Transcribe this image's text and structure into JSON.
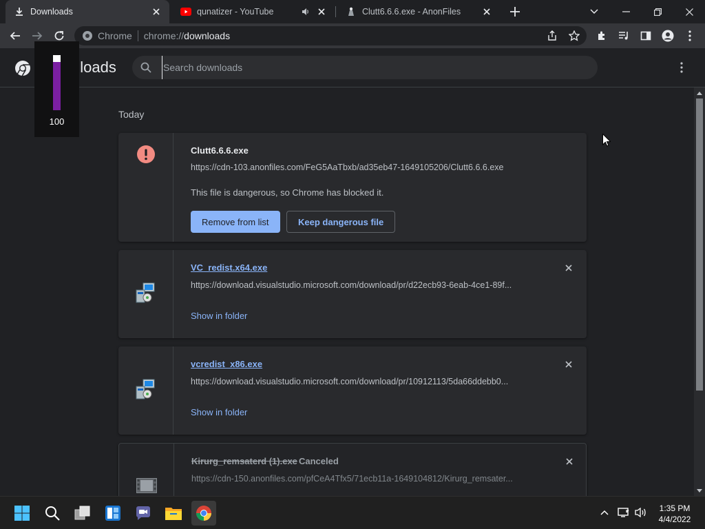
{
  "tabs": [
    {
      "title": "Downloads",
      "icon": "download-icon",
      "active": true
    },
    {
      "title": "qunatizer - YouTube",
      "icon": "youtube-icon",
      "audio": true
    },
    {
      "title": "Clutt6.6.6.exe - AnonFiles",
      "icon": "anonfiles-icon"
    }
  ],
  "omnibox": {
    "scheme": "Chrome",
    "host": "chrome://",
    "path": "downloads"
  },
  "header": {
    "title": "Downloads",
    "search_placeholder": "Search downloads"
  },
  "volume": {
    "value": "100",
    "level_percent": 100
  },
  "section": {
    "label": "Today"
  },
  "downloads": [
    {
      "name": "Clutt6.6.6.exe",
      "url": "https://cdn-103.anonfiles.com/FeG5AaTbxb/ad35eb47-1649105206/Clutt6.6.6.exe",
      "warning": "This file is dangerous, so Chrome has blocked it.",
      "primary_action": "Remove from list",
      "secondary_action": "Keep dangerous file",
      "icon": "error-icon"
    },
    {
      "name": "VC_redist.x64.exe",
      "url": "https://download.visualstudio.microsoft.com/download/pr/d22ecb93-6eab-4ce1-89f...",
      "action": "Show in folder",
      "icon": "installer-icon"
    },
    {
      "name": "vcredist_x86.exe",
      "url": "https://download.visualstudio.microsoft.com/download/pr/10912113/5da66ddebb0...",
      "action": "Show in folder",
      "icon": "installer-icon"
    },
    {
      "name": "Kirurg_remsaterd (1).exe",
      "status": "Canceled",
      "url": "https://cdn-150.anonfiles.com/pfCeA4Tfx5/71ecb11a-1649104812/Kirurg_remsater...",
      "icon": "video-file-icon"
    }
  ],
  "taskbar": {
    "apps": [
      "windows-start-icon",
      "search-icon",
      "task-view-icon",
      "widgets-icon",
      "teams-chat-icon",
      "file-explorer-icon",
      "chrome-icon"
    ],
    "clock": {
      "time": "1:35 PM",
      "date": "4/4/2022"
    }
  },
  "colors": {
    "accent": "#8ab4f8",
    "danger": "#f28b82",
    "volume": "#7b1fa2"
  }
}
